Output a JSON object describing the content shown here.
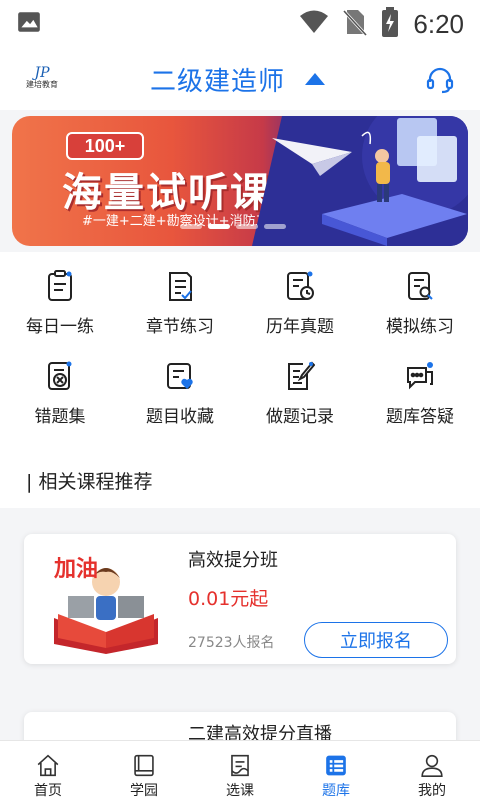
{
  "status_bar": {
    "time": "6:20",
    "icons": [
      "image-icon",
      "wifi-icon",
      "no-sim-icon",
      "battery-charging-icon"
    ]
  },
  "header": {
    "logo_text": "建培教育",
    "logo_mark": "JP",
    "title": "二级建造师",
    "title_icon": "caret-up-icon",
    "support_icon": "headset-icon",
    "accent_color": "#1c73e8"
  },
  "banner": {
    "badge": "100+",
    "title": "海量试听课程",
    "subtitle": "#一建+二建+勘察设计+消防工程师#",
    "art_icon": "paper-plane-illustration",
    "slide_count": 4,
    "active_slide": 1
  },
  "menu": {
    "items": [
      {
        "label": "每日一练",
        "icon": "daily-practice-icon"
      },
      {
        "label": "章节练习",
        "icon": "chapter-practice-icon"
      },
      {
        "label": "历年真题",
        "icon": "past-exams-icon"
      },
      {
        "label": "模拟练习",
        "icon": "mock-exam-icon"
      },
      {
        "label": "错题集",
        "icon": "wrong-questions-icon"
      },
      {
        "label": "题目收藏",
        "icon": "favorites-icon"
      },
      {
        "label": "做题记录",
        "icon": "history-record-icon"
      },
      {
        "label": "题库答疑",
        "icon": "qa-chat-icon"
      }
    ]
  },
  "section": {
    "title": "| 相关课程推荐"
  },
  "courses": [
    {
      "title": "高效提分班",
      "price": "0.01元起",
      "enrolled": "27523人报名",
      "button": "立即报名",
      "thumb_icon": "cheer-student-illustration",
      "thumb_text": "加油"
    },
    {
      "title": "二建高效提分直播"
    }
  ],
  "bottom_nav": {
    "items": [
      {
        "label": "首页",
        "icon": "home-icon"
      },
      {
        "label": "学园",
        "icon": "book-icon"
      },
      {
        "label": "选课",
        "icon": "course-select-icon"
      },
      {
        "label": "题库",
        "icon": "question-bank-icon",
        "active": true
      },
      {
        "label": "我的",
        "icon": "profile-icon"
      }
    ]
  },
  "colors": {
    "accent": "#1c73e8",
    "price_red": "#e5312d"
  }
}
